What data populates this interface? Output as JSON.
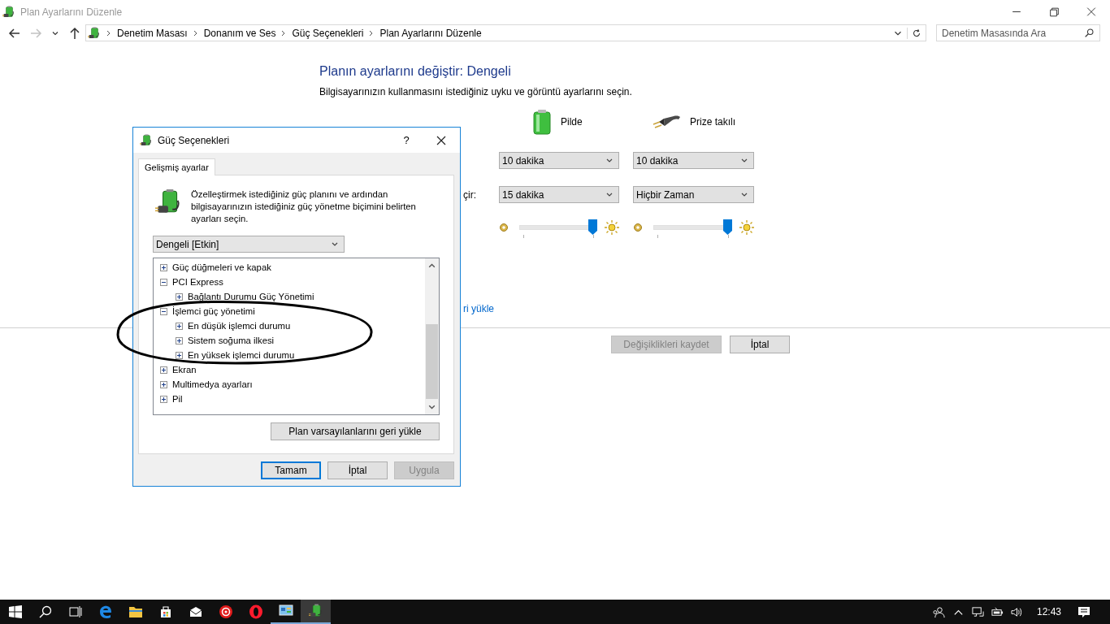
{
  "window": {
    "title": "Plan Ayarlarını Düzenle"
  },
  "nav": [
    {
      "kind": "back",
      "disabled": false
    },
    {
      "kind": "forward",
      "disabled": true
    },
    {
      "kind": "recent",
      "disabled": false
    },
    {
      "kind": "up",
      "disabled": false
    }
  ],
  "breadcrumb": [
    "Denetim Masası",
    "Donanım ve Ses",
    "Güç Seçenekleri",
    "Plan Ayarlarını Düzenle"
  ],
  "search": {
    "placeholder": "Denetim Masasında Ara"
  },
  "plan": {
    "heading": "Planın ayarlarını değiştir: Dengeli",
    "subtitle": "Bilgisayarınızın kullanmasını istediğiniz uyku ve görüntü ayarlarını seçin.",
    "columns": [
      {
        "kind": "battery",
        "label": "Pilde"
      },
      {
        "kind": "plugged",
        "label": "Prize takılı"
      }
    ],
    "rows": [
      {
        "kind": "dropdown",
        "values": [
          "10 dakika",
          "10 dakika"
        ]
      },
      {
        "kind": "dropdown",
        "label": "çir:",
        "values": [
          "15 dakika",
          "Hiçbir Zaman"
        ]
      },
      {
        "kind": "slider",
        "sliders": [
          {
            "level": 1
          },
          {
            "level": 1
          }
        ]
      }
    ],
    "restore_link": "ri yükle",
    "buttons": [
      {
        "label": "Değişiklikleri kaydet",
        "disabled": true
      },
      {
        "label": "İptal",
        "disabled": false
      }
    ]
  },
  "dialog": {
    "title": "Güç Seçenekleri",
    "help": "?",
    "tabs": [
      {
        "label": "Gelişmiş ayarlar",
        "selected": true
      }
    ],
    "intro": "Özelleştirmek istediğiniz güç planını ve ardından bilgisayarınızın istediğiniz güç yönetme biçimini belirten ayarları seçin.",
    "plan_select": "Dengeli [Etkin]",
    "tree": [
      {
        "label": "Güç düğmeleri ve kapak",
        "expanded": false
      },
      {
        "label": "PCI Express",
        "expanded": true,
        "children": [
          {
            "label": "Bağlantı Durumu Güç Yönetimi",
            "expanded": false
          }
        ]
      },
      {
        "label": "İşlemci güç yönetimi",
        "expanded": true,
        "children": [
          {
            "label": "En düşük işlemci durumu",
            "expanded": false
          },
          {
            "label": "Sistem soğuma ilkesi",
            "expanded": false
          },
          {
            "label": "En yüksek işlemci durumu",
            "expanded": false
          }
        ]
      },
      {
        "label": "Ekran",
        "expanded": false
      },
      {
        "label": "Multimedya ayarları",
        "expanded": false
      },
      {
        "label": "Pil",
        "expanded": false
      }
    ],
    "restore_button": "Plan varsayılanlarını geri yükle",
    "buttons": [
      {
        "label": "Tamam",
        "default": true,
        "disabled": false
      },
      {
        "label": "İptal",
        "default": false,
        "disabled": false
      },
      {
        "label": "Uygula",
        "default": false,
        "disabled": true
      }
    ]
  },
  "taskbar": {
    "apps": [
      {
        "kind": "start",
        "running": false,
        "selected": false
      },
      {
        "kind": "search",
        "running": false,
        "selected": false
      },
      {
        "kind": "taskview",
        "running": false,
        "selected": false
      },
      {
        "kind": "edge",
        "running": false,
        "selected": false
      },
      {
        "kind": "explorer",
        "running": false,
        "selected": false
      },
      {
        "kind": "store",
        "running": false,
        "selected": false
      },
      {
        "kind": "mail",
        "running": false,
        "selected": false
      },
      {
        "kind": "red-app",
        "running": false,
        "selected": false
      },
      {
        "kind": "opera",
        "running": false,
        "selected": false
      },
      {
        "kind": "panel",
        "running": true,
        "selected": false
      },
      {
        "kind": "power",
        "running": true,
        "selected": true
      }
    ],
    "tray": [
      {
        "kind": "people"
      },
      {
        "kind": "chevron"
      },
      {
        "kind": "network"
      },
      {
        "kind": "power"
      },
      {
        "kind": "volume"
      }
    ],
    "clock": "12:43"
  }
}
